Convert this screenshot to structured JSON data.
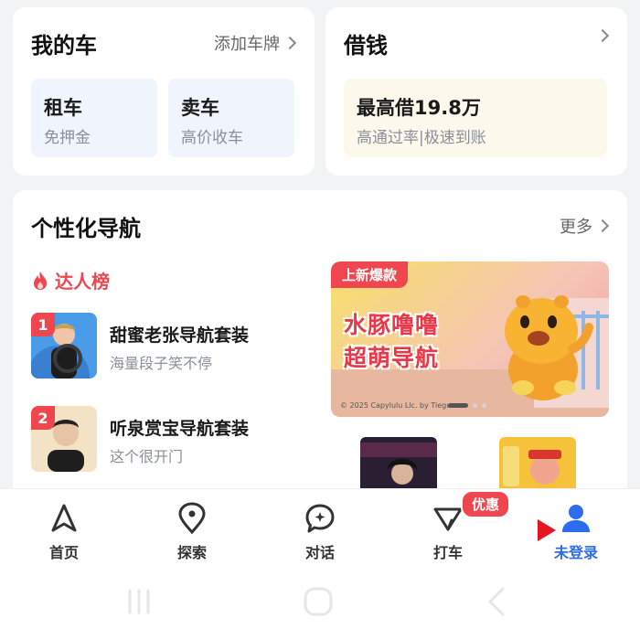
{
  "my_car": {
    "title": "我的车",
    "add_plate": "添加车牌",
    "tiles": [
      {
        "title": "租车",
        "sub": "免押金"
      },
      {
        "title": "卖车",
        "sub": "高价收车"
      }
    ]
  },
  "loan": {
    "title": "借钱",
    "main": "最高借19.8万",
    "sub": "高通过率|极速到账"
  },
  "personal_nav": {
    "title": "个性化导航",
    "more": "更多",
    "hot_list": "达人榜",
    "items": [
      {
        "rank": "1",
        "title": "甜蜜老张导航套装",
        "sub": "海量段子笑不停"
      },
      {
        "rank": "2",
        "title": "听泉赏宝导航套装",
        "sub": "这个很开门"
      }
    ],
    "banner": {
      "tag": "上新爆款",
      "line1": "水豚噜噜",
      "line2": "超萌导航",
      "copyright": "© 2025 Capylulu Llc. by Tieguan"
    }
  },
  "tabbar": {
    "items": [
      {
        "label": "首页",
        "icon": "navigation-arrow-icon"
      },
      {
        "label": "探索",
        "icon": "location-pin-icon"
      },
      {
        "label": "对话",
        "icon": "chat-bubble-icon"
      },
      {
        "label": "打车",
        "icon": "taxi-icon"
      },
      {
        "label": "未登录",
        "icon": "user-icon"
      }
    ],
    "promo_badge": "优惠"
  },
  "colors": {
    "accent_blue": "#2b6cf0",
    "accent_red": "#f0464f",
    "background": "#f2f3f5"
  }
}
